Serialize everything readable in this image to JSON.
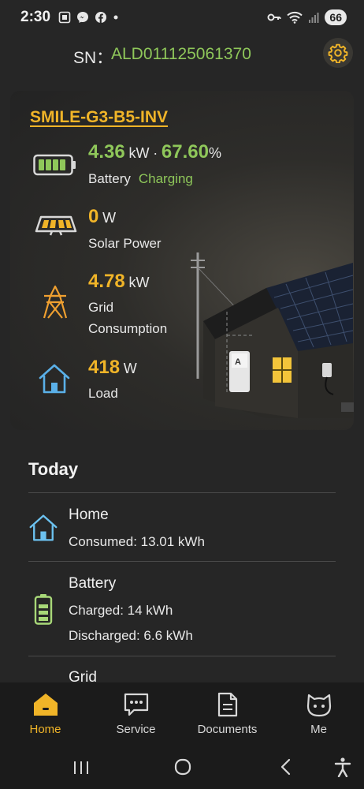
{
  "status_bar": {
    "time": "2:30",
    "battery_level": "66",
    "icons": [
      "screenshot-icon",
      "messenger-icon",
      "facebook-icon",
      "dot-icon",
      "key-icon",
      "wifi-icon",
      "signal-icon"
    ]
  },
  "header": {
    "sn_label": "SN：",
    "sn_value": "ALD011125061370",
    "settings_icon": "gear-icon"
  },
  "device": {
    "model": "SMILE-G3-B5-INV",
    "battery": {
      "power": "4.36",
      "power_unit": "kW",
      "separator": "·",
      "soc": "67.60",
      "soc_unit": "%",
      "label": "Battery",
      "status": "Charging"
    },
    "solar": {
      "power": "0",
      "unit": "W",
      "label": "Solar Power"
    },
    "grid": {
      "power": "4.78",
      "unit": "kW",
      "label_line1": "Grid",
      "label_line2": "Consumption"
    },
    "load": {
      "power": "418",
      "unit": "W",
      "label": "Load"
    }
  },
  "today": {
    "title": "Today",
    "home": {
      "title": "Home",
      "consumed": "Consumed: 13.01 kWh"
    },
    "battery": {
      "title": "Battery",
      "charged": "Charged: 14 kWh",
      "discharged": "Discharged: 6.6 kWh"
    },
    "grid": {
      "title": "Grid"
    }
  },
  "bottom_nav": {
    "items": [
      {
        "label": "Home",
        "icon": "home-icon",
        "active": true
      },
      {
        "label": "Service",
        "icon": "chat-icon",
        "active": false
      },
      {
        "label": "Documents",
        "icon": "document-icon",
        "active": false
      },
      {
        "label": "Me",
        "icon": "cat-face-icon",
        "active": false
      }
    ]
  },
  "colors": {
    "accent_orange": "#f0b428",
    "accent_green": "#8fc75a",
    "background": "#262626",
    "nav_background": "#1b1b1b"
  }
}
